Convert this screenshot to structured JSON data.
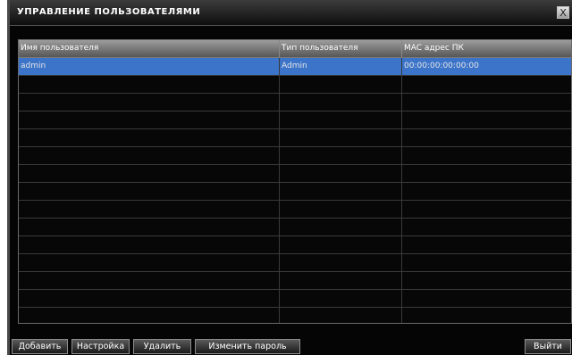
{
  "window": {
    "title": "УПРАВЛЕНИЕ ПОЛЬЗОВАТЕЛЯМИ",
    "close_label": "X"
  },
  "table": {
    "columns": [
      "Имя пользователя",
      "Тип пользователя",
      "MAC адрес ПК"
    ],
    "rows": [
      [
        "admin",
        "Admin",
        "00:00:00:00:00:00"
      ],
      [
        "",
        "",
        ""
      ],
      [
        "",
        "",
        ""
      ],
      [
        "",
        "",
        ""
      ],
      [
        "",
        "",
        ""
      ],
      [
        "",
        "",
        ""
      ],
      [
        "",
        "",
        ""
      ],
      [
        "",
        "",
        ""
      ],
      [
        "",
        "",
        ""
      ],
      [
        "",
        "",
        ""
      ],
      [
        "",
        "",
        ""
      ],
      [
        "",
        "",
        ""
      ],
      [
        "",
        "",
        ""
      ],
      [
        "",
        "",
        ""
      ],
      [
        "",
        "",
        ""
      ]
    ],
    "selected_row": 0
  },
  "buttons": {
    "add": "Добавить",
    "setup": "Настройка",
    "delete": "Удалить",
    "change_password": "Изменить пароль",
    "exit": "Выйти"
  },
  "colors": {
    "selection": "#3b74c9",
    "background": "#050505",
    "header": "#7a7a7a"
  }
}
